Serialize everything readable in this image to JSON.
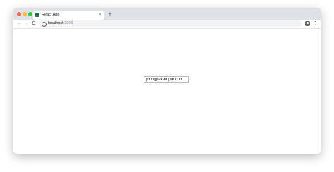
{
  "browser": {
    "tab": {
      "title": "React App",
      "favicon_icon": "react-app-favicon-icon",
      "favicon_color": "#1f6b4a",
      "close_glyph": "×"
    },
    "new_tab_glyph": "+",
    "nav": {
      "back_glyph": "←",
      "forward_glyph": "→",
      "reload_glyph": "C"
    },
    "address": {
      "info_glyph": "i",
      "host": "localhost",
      "port": ":3000"
    },
    "menu_glyph": "⋮"
  },
  "page": {
    "email_input": {
      "value": "john@example.com"
    }
  }
}
